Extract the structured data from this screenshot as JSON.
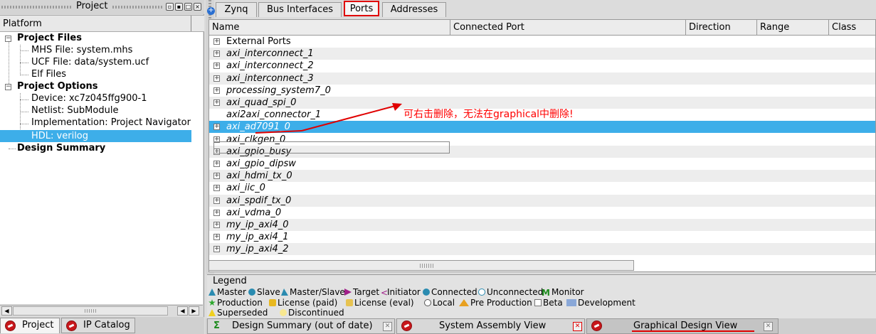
{
  "project_panel": {
    "title": "Project",
    "header": "Platform",
    "tree": {
      "project_files": "Project Files",
      "mhs_file": "MHS File: system.mhs",
      "ucf_file": "UCF File: data/system.ucf",
      "elf_files": "Elf Files",
      "project_options": "Project Options",
      "device": "Device: xc7z045ffg900-1",
      "netlist": "Netlist: SubModule",
      "implementation": "Implementation: Project Navigator",
      "hdl": "HDL: verilog",
      "design_summary": "Design Summary"
    },
    "tabs": {
      "project": "Project",
      "ip_catalog": "IP Catalog"
    }
  },
  "top_tabs": [
    "Zynq",
    "Bus Interfaces",
    "Ports",
    "Addresses"
  ],
  "active_top_tab": "Ports",
  "columns": [
    "Name",
    "Connected Port",
    "Direction",
    "Range",
    "Class"
  ],
  "rows": [
    "External Ports",
    "axi_interconnect_1",
    "axi_interconnect_2",
    "axi_interconnect_3",
    "processing_system7_0",
    "axi_quad_spi_0",
    "axi2axi_connector_1",
    "axi_ad7091_0",
    "axi_clkgen_0",
    "axi_gpio_busy",
    "axi_gpio_dipsw",
    "axi_hdmi_tx_0",
    "axi_iic_0",
    "axi_spdif_tx_0",
    "axi_vdma_0",
    "my_ip_axi4_0",
    "my_ip_axi4_1",
    "my_ip_axi4_2"
  ],
  "selected_row": "axi_ad7091_0",
  "annotation": "可右击删除，无法在graphical中删除!",
  "legend": {
    "title": "Legend",
    "line1": [
      "Master",
      "Slave",
      "Master/Slave",
      "Target",
      "Initiator",
      "Connected",
      "Unconnected",
      "Monitor"
    ],
    "line2": [
      "Production",
      "License (paid)",
      "License (eval)",
      "Local",
      "Pre Production",
      "Beta",
      "Development"
    ],
    "line3": [
      "Superseded",
      "Discontinued"
    ]
  },
  "bottom_tabs": {
    "design_summary": "Design Summary (out of date)",
    "system_assembly": "System Assembly View",
    "graphical": "Graphical Design View"
  },
  "colors": {
    "selection": "#3daee9",
    "annotation": "#ff0000"
  }
}
